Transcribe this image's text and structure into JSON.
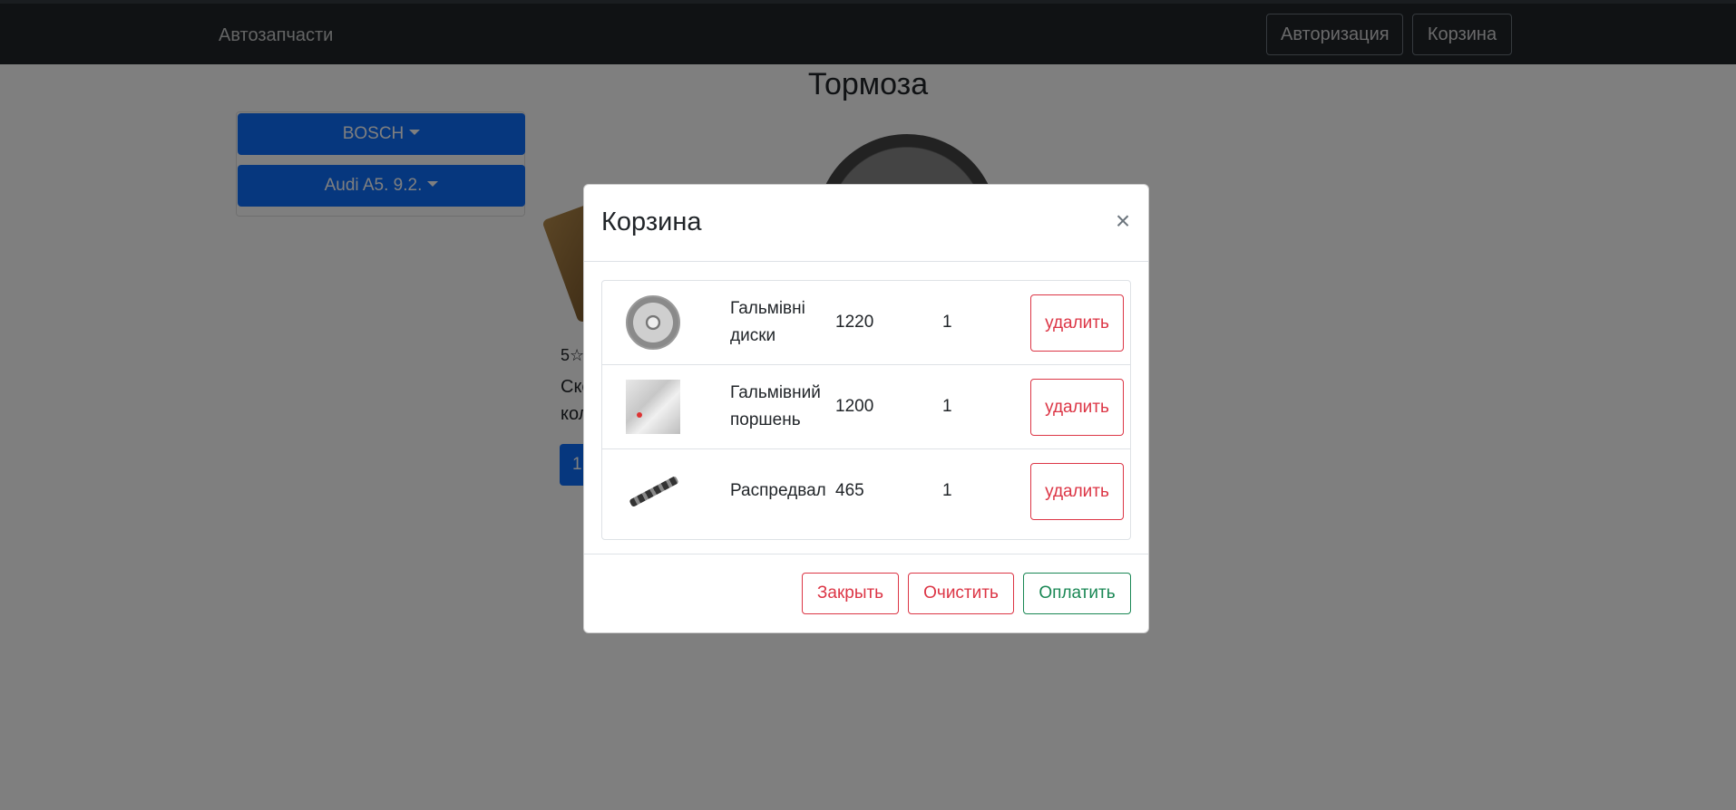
{
  "navbar": {
    "brand": "Автозапчасти",
    "login_label": "Авторизация",
    "cart_label": "Корзина"
  },
  "page": {
    "title": "Тормоза"
  },
  "sidebar": {
    "brand_filter": "BOSCH",
    "model_filter": "Audi A5. 9.2."
  },
  "product": {
    "rating": "5",
    "description_partial": "Ско\nкол",
    "button_partial": "1"
  },
  "modal": {
    "title": "Корзина",
    "close_symbol": "×",
    "items": [
      {
        "name": "Гальмівні диски",
        "price": "1220",
        "qty": "1",
        "image": "brake-disc-image",
        "delete_label": "удалить"
      },
      {
        "name": "Гальмівний поршень",
        "price": "1200",
        "qty": "1",
        "image": "brake-piston-image",
        "delete_label": "удалить"
      },
      {
        "name": "Распредвал",
        "price": "465",
        "qty": "1",
        "image": "camshaft-image",
        "delete_label": "удалить"
      }
    ],
    "footer": {
      "close_label": "Закрыть",
      "clear_label": "Очистить",
      "pay_label": "Оплатить"
    }
  },
  "colors": {
    "primary": "#0d6efd",
    "danger": "#dc3545",
    "success": "#198754",
    "navbar": "#212529"
  }
}
